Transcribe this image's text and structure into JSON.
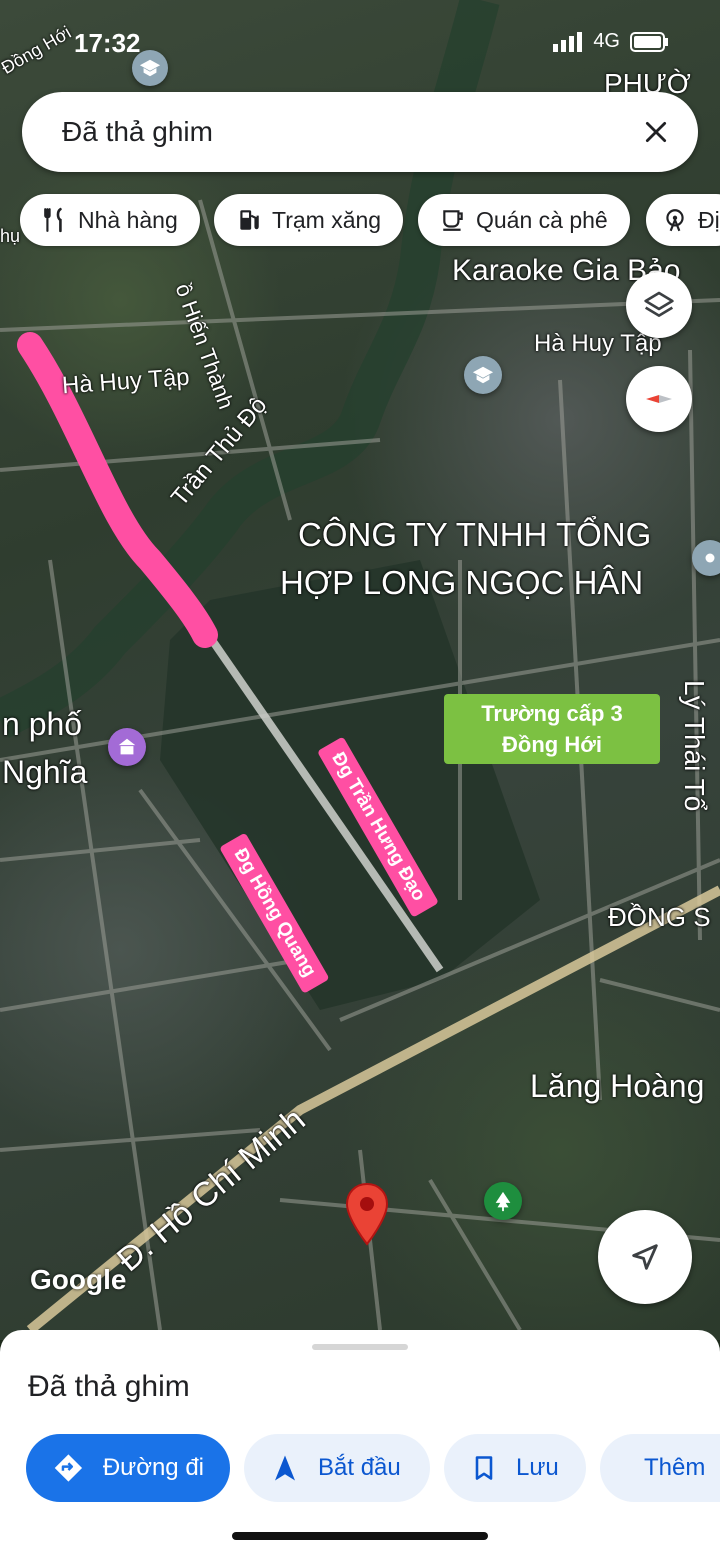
{
  "status_bar": {
    "time": "17:32",
    "network": "4G"
  },
  "search": {
    "value": "Đã thả ghim"
  },
  "chips": [
    {
      "label": "Nhà hàng",
      "icon": "fork-knife-icon"
    },
    {
      "label": "Trạm xăng",
      "icon": "gas-station-icon"
    },
    {
      "label": "Quán cà phê",
      "icon": "coffee-cup-icon"
    },
    {
      "label": "Đị",
      "icon": "ferris-wheel-icon"
    }
  ],
  "map": {
    "labels": {
      "dong_hoi_corner": "Đồng Hới",
      "phuong_partial": "PHƯỜ",
      "karaoke": "Karaoke Gia Bảo",
      "ha_huy_tap_right": "Hà Huy Tập",
      "ha_huy_tap_left": "Hà Huy Tập",
      "hien_thanh": "ồ Hiến Thành",
      "tran_thu_do": "Trần Thủ Độ",
      "company_line1": "CÔNG TY TNHH TỔNG",
      "company_line2": "HỢP LONG NGỌC HÂN",
      "pho_nghia_line1": "n phố",
      "pho_nghia_line2": "Nghĩa",
      "ly_thai_to": "Lý Thái Tổ",
      "dong_s": "ĐỒNG S",
      "lang_hoang": "Lăng Hoàng",
      "ho_chi_minh": "Đ. Hồ Chí Minh",
      "hu_partial": "hụ"
    },
    "tags": {
      "school_line1": "Trường cấp 3",
      "school_line2": "Đồng Hới",
      "tran_hung_dao": "Đg Trần Hưng Đạo",
      "hong_quang": "Đg Hồng Quang"
    },
    "google_logo": "Google",
    "colors": {
      "highlight": "#ff4fa3",
      "pin": "#ea4335",
      "school_tag": "#7cc142"
    }
  },
  "bottom_sheet": {
    "title": "Đã thả ghim",
    "actions": [
      {
        "label": "Đường đi",
        "icon": "directions-icon",
        "primary": true
      },
      {
        "label": "Bắt đầu",
        "icon": "navigation-arrow-icon",
        "primary": false
      },
      {
        "label": "Lưu",
        "icon": "bookmark-icon",
        "primary": false
      },
      {
        "label": "Thêm",
        "icon": "flag-icon",
        "primary": false
      }
    ]
  }
}
